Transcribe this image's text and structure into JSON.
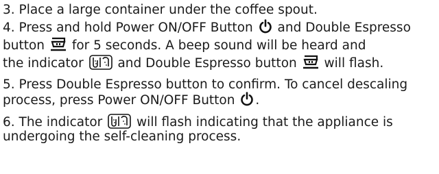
{
  "steps": [
    {
      "id": "step-3",
      "line1": "3. Place a large container under the coffee spout."
    },
    {
      "id": "step-4",
      "line1_pre": "4. Press and hold Power ON/OFF Button",
      "line1_mid": "and Double Espresso",
      "line2_pre": "button",
      "line2_post": "for 5 seconds. A beep sound will be heard and",
      "line3_pre": "the indicator",
      "line3_mid": "and Double Espresso button",
      "line3_post": "will flash."
    },
    {
      "id": "step-5",
      "line1": "5. Press Double Espresso button to confirm. To cancel descaling",
      "line2_pre": "process, press Power ON/OFF Button",
      "line2_post": "."
    },
    {
      "id": "step-6",
      "line1_pre": "6. The indicator",
      "line1_post": "will flash indicating that the appliance is",
      "line2": "undergoing the self-cleaning process."
    }
  ],
  "icons": {
    "power": "power-icon",
    "double_espresso": "double-espresso-icon",
    "descale_indicator": "descale-indicator-icon"
  }
}
